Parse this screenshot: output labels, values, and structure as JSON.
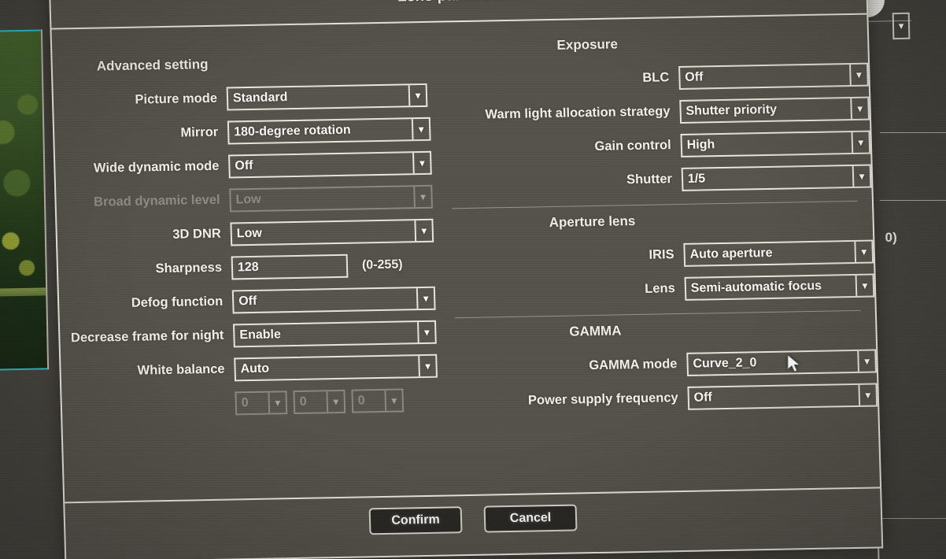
{
  "dialog": {
    "title": "Lens parameters",
    "confirm_label": "Confirm",
    "cancel_label": "Cancel"
  },
  "left_column": {
    "section_title": "Advanced setting",
    "rows": [
      {
        "label": "Picture mode",
        "value": "Standard",
        "control": "select",
        "disabled": false
      },
      {
        "label": "Mirror",
        "value": "180-degree rotation",
        "control": "select",
        "disabled": false
      },
      {
        "label": "Wide dynamic mode",
        "value": "Off",
        "control": "select",
        "disabled": false
      },
      {
        "label": "Broad dynamic level",
        "value": "Low",
        "control": "select",
        "disabled": true
      },
      {
        "label": "3D DNR",
        "value": "Low",
        "control": "select",
        "disabled": false
      },
      {
        "label": "Sharpness",
        "value": "128",
        "control": "text",
        "disabled": false,
        "hint": "(0-255)"
      },
      {
        "label": "Defog function",
        "value": "Off",
        "control": "select",
        "disabled": false
      },
      {
        "label": "Decrease frame for night",
        "value": "Enable",
        "control": "select",
        "disabled": false
      },
      {
        "label": "White balance",
        "value": "Auto",
        "control": "select",
        "disabled": false
      }
    ],
    "wb_subvalues": [
      "0",
      "0",
      "0"
    ]
  },
  "right_column": {
    "exposure": {
      "section_title": "Exposure",
      "rows": [
        {
          "label": "BLC",
          "value": "Off"
        },
        {
          "label": "Warm light allocation strategy",
          "value": "Shutter priority"
        },
        {
          "label": "Gain control",
          "value": "High"
        },
        {
          "label": "Shutter",
          "value": "1/5"
        }
      ]
    },
    "aperture": {
      "section_title": "Aperture lens",
      "rows": [
        {
          "label": "IRIS",
          "value": "Auto aperture"
        },
        {
          "label": "Lens",
          "value": "Semi-automatic focus"
        }
      ]
    },
    "gamma": {
      "section_title": "GAMMA",
      "rows": [
        {
          "label": "GAMMA mode",
          "value": "Curve_2_0"
        },
        {
          "label": "Power supply frequency",
          "value": "Off"
        }
      ]
    }
  },
  "background": {
    "range_text": "0)"
  },
  "icons": {
    "caret": "▾"
  },
  "colors": {
    "dialog_bg": "#57544d",
    "border": "#eceae2",
    "text": "#f3f2ec",
    "disabled_text": "#8f8c85",
    "button_bg": "#2c2a26",
    "roi_cyan": "#35c7d6"
  }
}
